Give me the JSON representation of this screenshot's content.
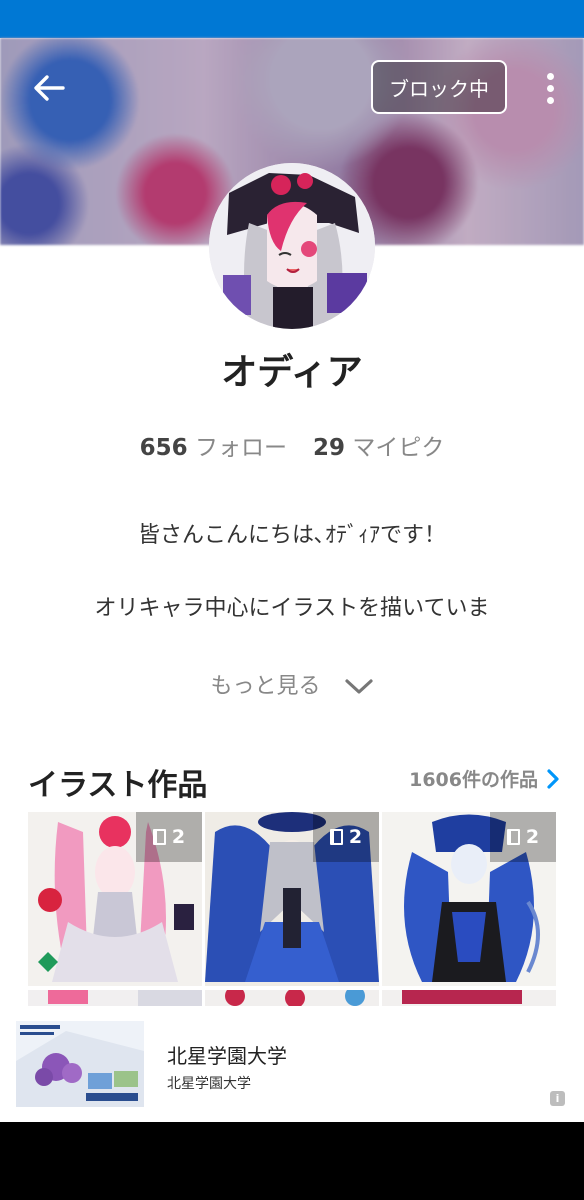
{
  "header": {
    "block_label": "ブロック中",
    "back_icon": "arrow-left-icon",
    "more_icon": "more-vertical-icon"
  },
  "profile": {
    "name": "オディア",
    "following_count": "656",
    "following_label": "フォロー",
    "mypick_count": "29",
    "mypick_label": "マイピク",
    "bio_line1": "皆さんこんにちは､ｵﾃﾞｨｱです！",
    "bio_line2": "オリキャラ中心にイラストを描いていま",
    "more_label": "もっと見る"
  },
  "illustrations": {
    "title": "イラスト作品",
    "count_label": "1606件の作品",
    "items": [
      {
        "pages": "2"
      },
      {
        "pages": "2"
      },
      {
        "pages": "2"
      }
    ]
  },
  "ad": {
    "title": "北星学園大学",
    "subtitle": "北星学園大学",
    "info_label": "i"
  },
  "colors": {
    "status_bar": "#0078d4",
    "accent": "#0096fa",
    "nav_bar": "#000000"
  }
}
